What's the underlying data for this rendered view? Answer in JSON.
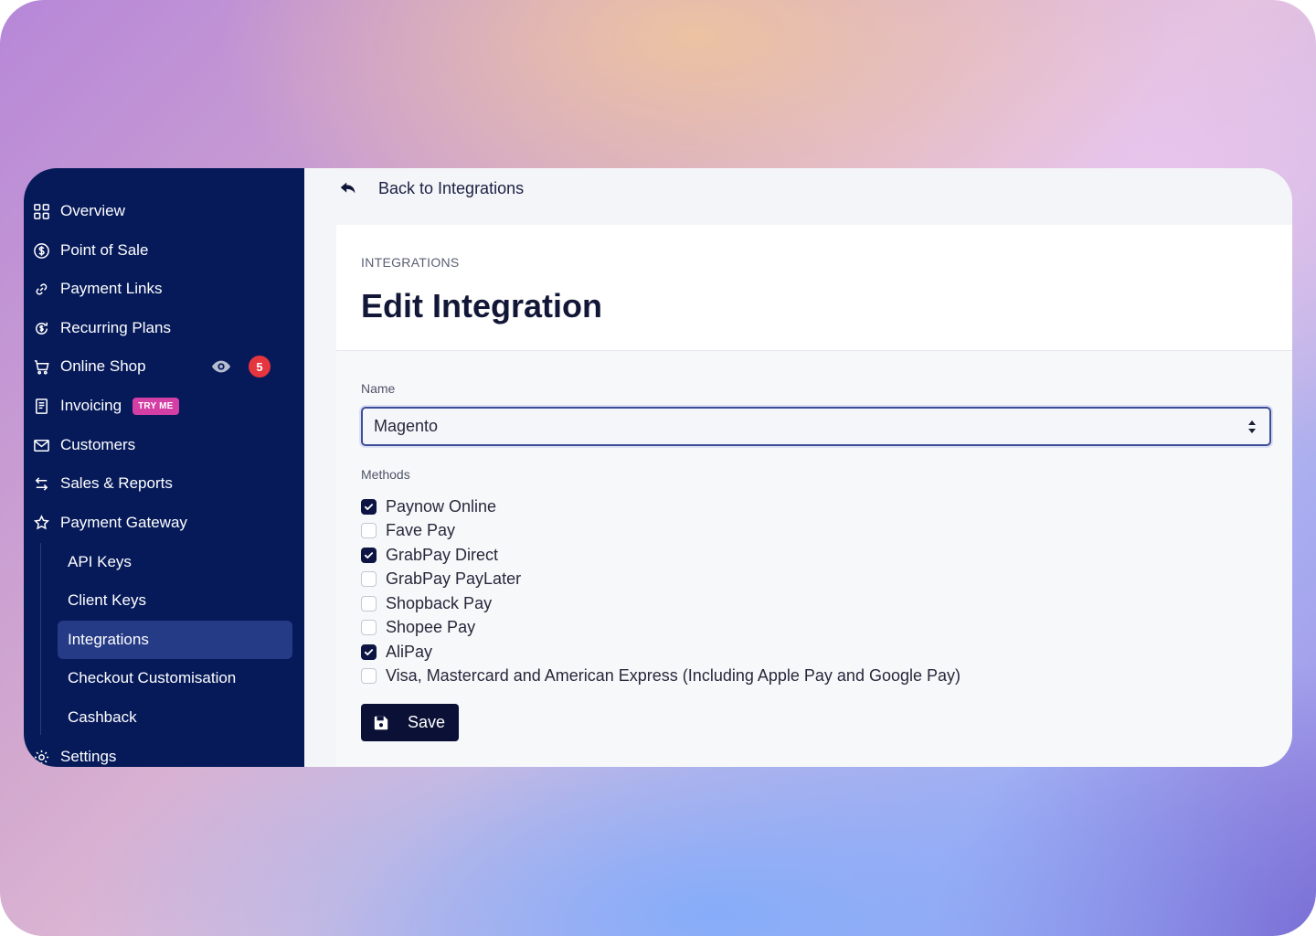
{
  "sidebar": {
    "items": [
      {
        "label": "Overview",
        "icon": "grid-icon"
      },
      {
        "label": "Point of Sale",
        "icon": "dollar-circle-icon"
      },
      {
        "label": "Payment Links",
        "icon": "link-icon"
      },
      {
        "label": "Recurring Plans",
        "icon": "recurring-icon"
      },
      {
        "label": "Online Shop",
        "icon": "cart-icon"
      },
      {
        "label": "Invoicing",
        "icon": "invoice-icon"
      },
      {
        "label": "Customers",
        "icon": "mail-icon"
      },
      {
        "label": "Sales & Reports",
        "icon": "arrows-icon"
      },
      {
        "label": "Payment Gateway",
        "icon": "puzzle-icon"
      },
      {
        "label": "Settings",
        "icon": "gear-icon"
      }
    ],
    "online_shop_badge": "5",
    "invoicing_badge": "TRY ME",
    "subitems": [
      {
        "label": "API Keys"
      },
      {
        "label": "Client Keys"
      },
      {
        "label": "Integrations"
      },
      {
        "label": "Checkout Customisation"
      },
      {
        "label": "Cashback"
      }
    ],
    "active_subitem": "Integrations"
  },
  "header": {
    "back_label": "Back to Integrations",
    "breadcrumb": "INTEGRATIONS",
    "title": "Edit Integration"
  },
  "form": {
    "name_label": "Name",
    "name_value": "Magento",
    "methods_label": "Methods",
    "methods": [
      {
        "label": "Paynow Online",
        "checked": true
      },
      {
        "label": "Fave Pay",
        "checked": false
      },
      {
        "label": "GrabPay Direct",
        "checked": true
      },
      {
        "label": "GrabPay PayLater",
        "checked": false
      },
      {
        "label": "Shopback Pay",
        "checked": false
      },
      {
        "label": "Shopee Pay",
        "checked": false
      },
      {
        "label": "AliPay",
        "checked": true
      },
      {
        "label": "Visa, Mastercard and American Express (Including Apple Pay and Google Pay)",
        "checked": false
      }
    ],
    "save_label": "Save"
  },
  "colors": {
    "sidebar_bg": "#061a5a",
    "active_bg": "#253b86",
    "primary_dark": "#0b1136",
    "badge_red": "#e5353e",
    "badge_pink": "#d43fa6"
  }
}
